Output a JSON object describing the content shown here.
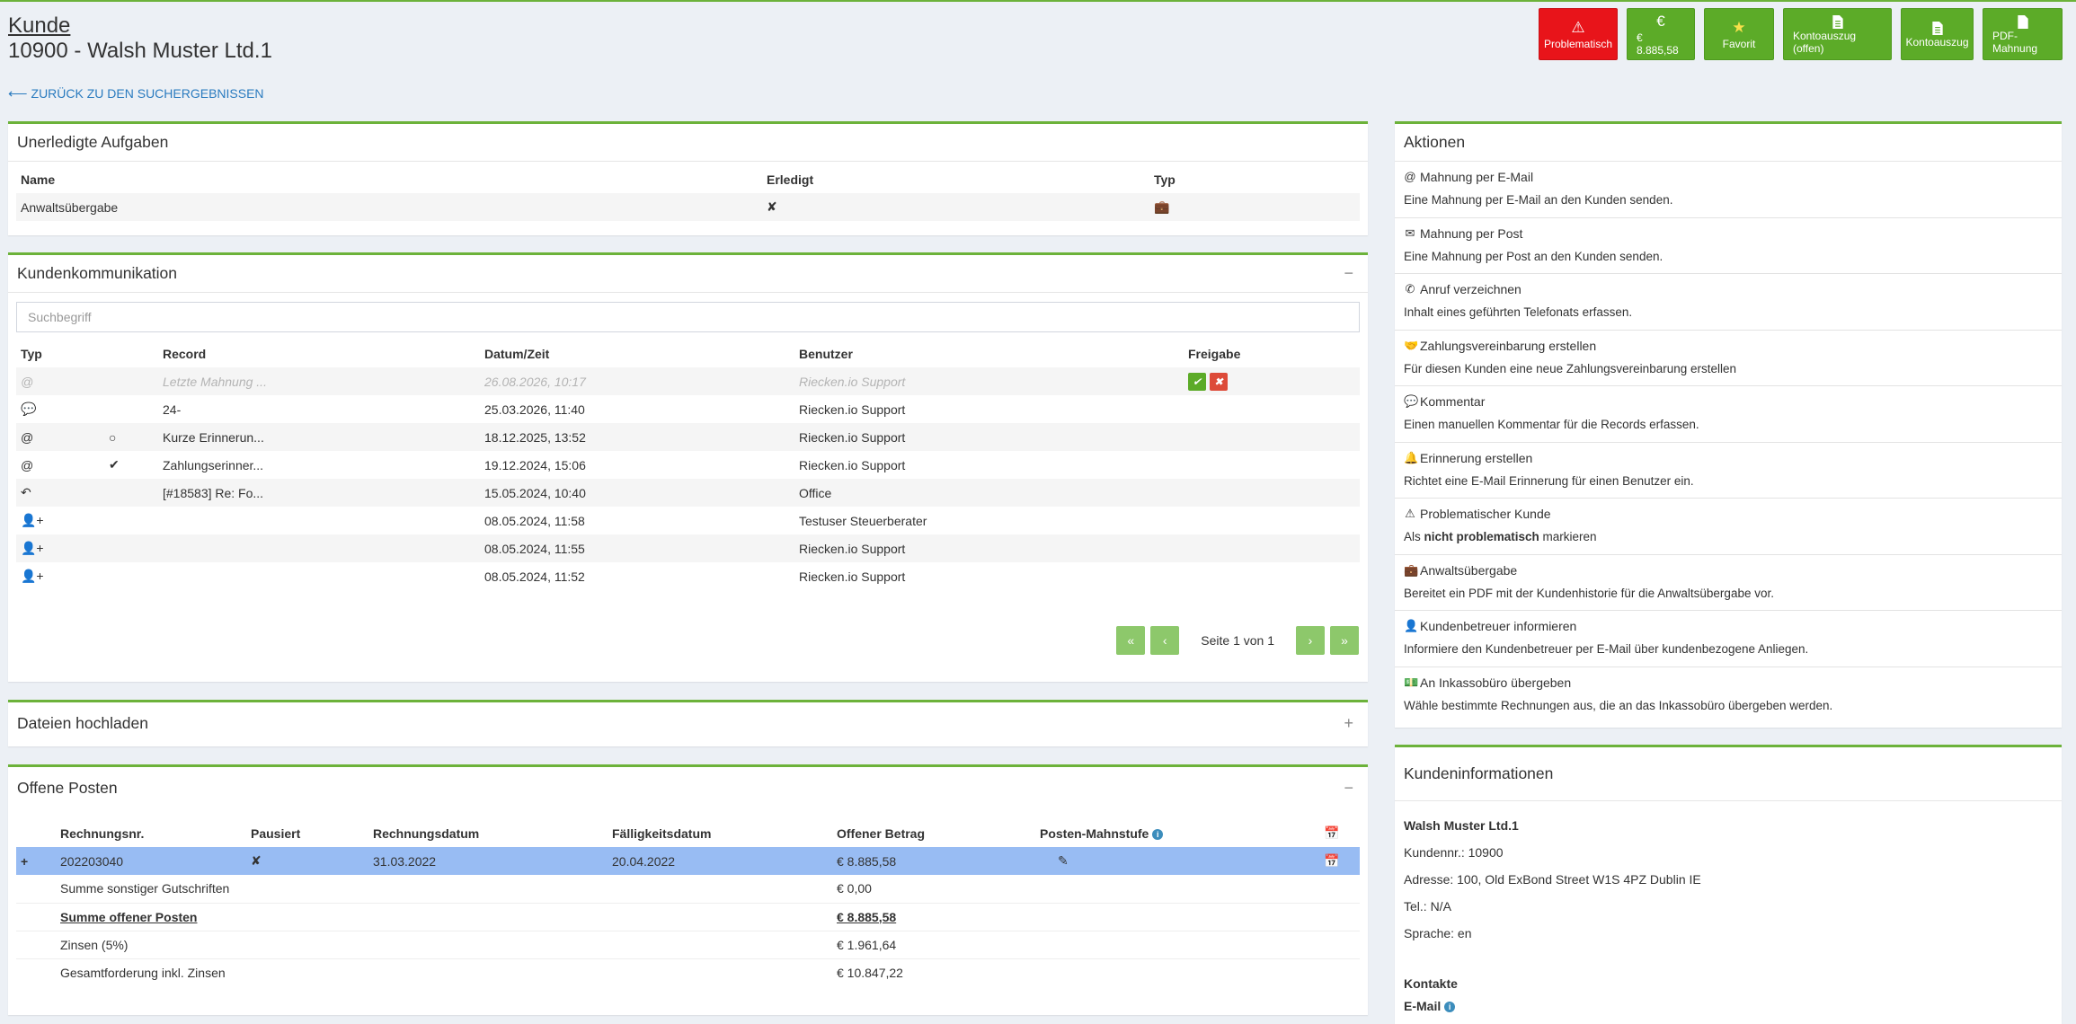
{
  "header": {
    "label": "Kunde",
    "title": "10900 - Walsh Muster Ltd.1",
    "back_link": "ZURÜCK ZU DEN SUCHERGEBNISSEN"
  },
  "top_buttons": [
    {
      "label": "Problematisch",
      "icon": "warning-icon",
      "color": "#e8141a"
    },
    {
      "label": "€ 8.885,58",
      "icon": "euro-icon",
      "color": "#5cab28"
    },
    {
      "label": "Favorit",
      "icon": "star-icon",
      "color": "#5cab28"
    },
    {
      "label": "Kontoauszug (offen)",
      "icon": "document-icon",
      "color": "#5cab28"
    },
    {
      "label": "Kontoauszug",
      "icon": "document-icon",
      "color": "#5cab28"
    },
    {
      "label": "PDF-Mahnung",
      "icon": "document-icon",
      "color": "#5cab28"
    }
  ],
  "tasks": {
    "title": "Unerledigte Aufgaben",
    "columns": [
      "Name",
      "Erledigt",
      "Typ"
    ],
    "rows": [
      {
        "name": "Anwaltsübergabe",
        "done": "✘",
        "type_icon": "briefcase-icon"
      }
    ]
  },
  "communication": {
    "title": "Kundenkommunikation",
    "collapse": "−",
    "search_placeholder": "Suchbegriff",
    "columns": [
      "Typ",
      "Record",
      "Datum/Zeit",
      "Benutzer",
      "Freigabe"
    ],
    "rows": [
      {
        "type": "@",
        "status": "",
        "record": "Letzte Mahnung ...",
        "date": "26.08.2026, 10:17",
        "user": "Riecken.io Support",
        "approval": true
      },
      {
        "type": "💬",
        "status": "",
        "record": "24-",
        "date": "25.03.2026, 11:40",
        "user": "Riecken.io Support",
        "approval": false
      },
      {
        "type": "@",
        "status": "○",
        "record": "Kurze Erinnerun...",
        "date": "18.12.2025, 13:52",
        "user": "Riecken.io Support",
        "approval": false
      },
      {
        "type": "@",
        "status": "✔",
        "record": "Zahlungserinner...",
        "date": "19.12.2024, 15:06",
        "user": "Riecken.io Support",
        "approval": false
      },
      {
        "type": "↶",
        "status": "",
        "record": "[#18583] Re: Fo...",
        "date": "15.05.2024, 10:40",
        "user": "Office",
        "approval": false
      },
      {
        "type": "👤+",
        "status": "",
        "record": "",
        "date": "08.05.2024, 11:58",
        "user": "Testuser Steuerberater",
        "approval": false
      },
      {
        "type": "👤+",
        "status": "",
        "record": "",
        "date": "08.05.2024, 11:55",
        "user": "Riecken.io Support",
        "approval": false
      },
      {
        "type": "👤+",
        "status": "",
        "record": "",
        "date": "08.05.2024, 11:52",
        "user": "Riecken.io Support",
        "approval": false
      }
    ],
    "pager": {
      "first": "«",
      "prev": "‹",
      "label": "Seite 1 von 1",
      "next": "›",
      "last": "»"
    }
  },
  "uploads": {
    "title": "Dateien hochladen",
    "expand": "+"
  },
  "open_items": {
    "title": "Offene Posten",
    "collapse": "−",
    "columns": [
      "Rechnungsnr.",
      "Pausiert",
      "Rechnungsdatum",
      "Fälligkeitsdatum",
      "Offener Betrag",
      "Posten-Mahnstufe"
    ],
    "row": {
      "expand": "+",
      "number": "202203040",
      "paused": "✘",
      "invoice_date": "31.03.2022",
      "due_date": "20.04.2022",
      "amount": "€ 8.885,58"
    },
    "summary": [
      {
        "label": "Summe sonstiger Gutschriften",
        "value": "€ 0,00",
        "bold": false
      },
      {
        "label": "Summe offener Posten",
        "value": "€ 8.885,58",
        "bold": true
      },
      {
        "label": "Zinsen (5%)",
        "value": "€ 1.961,64",
        "bold": false
      },
      {
        "label": "Gesamtforderung inkl. Zinsen",
        "value": "€ 10.847,22",
        "bold": false
      }
    ]
  },
  "actions": {
    "title": "Aktionen",
    "items": [
      {
        "icon": "@",
        "title": "Mahnung per E-Mail",
        "desc": "Eine Mahnung per E-Mail an den Kunden senden."
      },
      {
        "icon": "✉",
        "title": "Mahnung per Post",
        "desc": "Eine Mahnung per Post an den Kunden senden."
      },
      {
        "icon": "✆",
        "title": "Anruf verzeichnen",
        "desc": "Inhalt eines geführten Telefonats erfassen."
      },
      {
        "icon": "🤝",
        "title": "Zahlungsvereinbarung erstellen",
        "desc": "Für diesen Kunden eine neue Zahlungsvereinbarung erstellen"
      },
      {
        "icon": "💬",
        "title": "Kommentar",
        "desc": "Einen manuellen Kommentar für die Records erfassen."
      },
      {
        "icon": "🔔",
        "title": "Erinnerung erstellen",
        "desc": "Richtet eine E-Mail Erinnerung für einen Benutzer ein."
      },
      {
        "icon": "⚠",
        "title": "Problematischer Kunde",
        "desc_pre": "Als ",
        "desc_bold": "nicht problematisch",
        "desc_post": " markieren"
      },
      {
        "icon": "💼",
        "title": "Anwaltsübergabe",
        "desc": "Bereitet ein PDF mit der Kundenhistorie für die Anwaltsübergabe vor."
      },
      {
        "icon": "👤",
        "title": "Kundenbetreuer informieren",
        "desc": "Informiere den Kundenbetreuer per E-Mail über kundenbezogene Anliegen."
      },
      {
        "icon": "💵",
        "title": "An Inkassobüro übergeben",
        "desc": "Wähle bestimmte Rechnungen aus, die an das Inkassobüro übergeben werden."
      }
    ]
  },
  "customer_info": {
    "title": "Kundeninformationen",
    "name": "Walsh Muster Ltd.1",
    "number": "Kundennr.: 10900",
    "address": "Adresse: 100, Old ExBond Street W1S 4PZ Dublin IE",
    "phone": "Tel.: N/A",
    "language": "Sprache: en",
    "contacts_title": "Kontakte",
    "email_label": "E-Mail"
  }
}
